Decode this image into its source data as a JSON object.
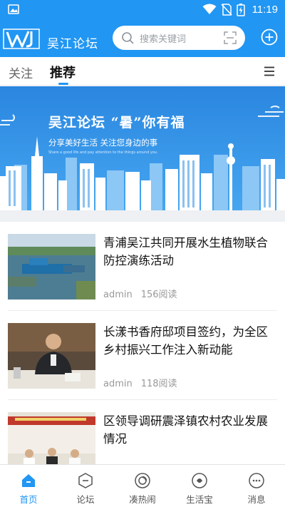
{
  "status_bar": {
    "time": "11:19"
  },
  "header": {
    "brand": "吴江论坛",
    "search_placeholder": "搜索关键词"
  },
  "tabs": [
    {
      "label": "关注",
      "active": false
    },
    {
      "label": "推荐",
      "active": true
    }
  ],
  "banner": {
    "title": "吴江论坛  “暑”你有福",
    "subtitle": "分享美好生活 关注您身边的事",
    "tagline": "Share a good life and pay attention to the things around you."
  },
  "articles": [
    {
      "title": "青浦吴江共同开展水生植物联合防控演练活动",
      "author": "admin",
      "reads": "156阅读"
    },
    {
      "title": "长漾书香府邸项目签约，为全区乡村振兴工作注入新动能",
      "author": "admin",
      "reads": "118阅读"
    },
    {
      "title": "区领导调研震泽镇农村农业发展情况",
      "author": "",
      "reads": ""
    }
  ],
  "bottom_nav": [
    {
      "label": "首页",
      "icon": "home-icon",
      "active": true
    },
    {
      "label": "论坛",
      "icon": "forum-icon",
      "active": false
    },
    {
      "label": "凑热闹",
      "icon": "hot-icon",
      "active": false
    },
    {
      "label": "生活宝",
      "icon": "life-icon",
      "active": false
    },
    {
      "label": "消息",
      "icon": "message-icon",
      "active": false
    }
  ],
  "colors": {
    "primary": "#2196F3",
    "banner": "#2e8fe6"
  }
}
